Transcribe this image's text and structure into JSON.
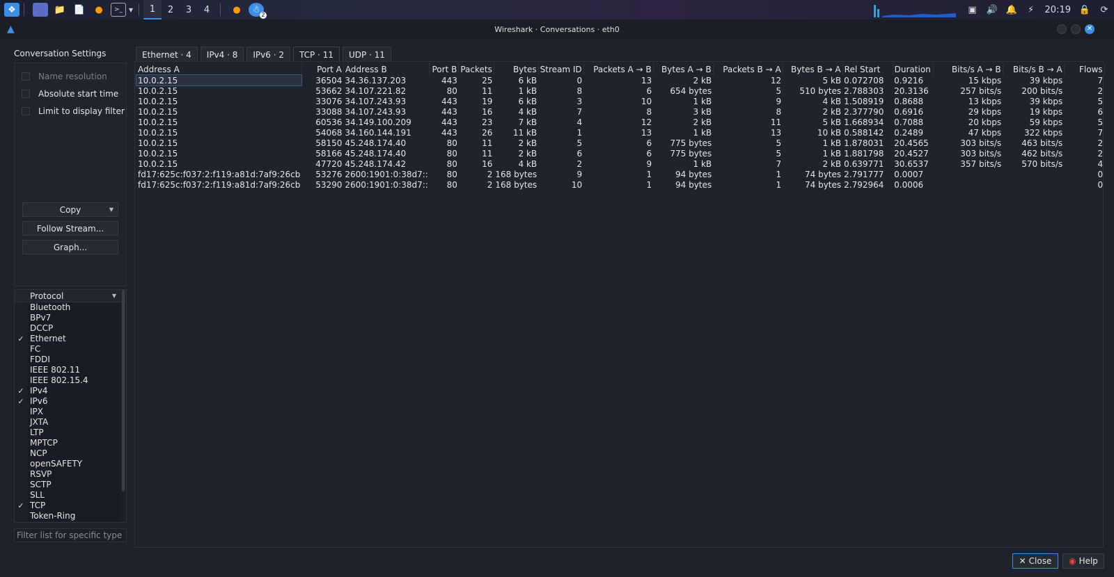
{
  "taskbar": {
    "workspaces": [
      "1",
      "2",
      "3",
      "4"
    ],
    "active_workspace": 0,
    "clock": "20:19",
    "badge": "2"
  },
  "window": {
    "title": "Wireshark · Conversations · eth0"
  },
  "settings": {
    "heading": "Conversation Settings",
    "options": [
      {
        "label": "Name resolution",
        "checked": false,
        "disabled": true
      },
      {
        "label": "Absolute start time",
        "checked": false,
        "disabled": false
      },
      {
        "label": "Limit to display filter",
        "checked": false,
        "disabled": false
      }
    ],
    "copy_label": "Copy",
    "follow_label": "Follow Stream...",
    "graph_label": "Graph..."
  },
  "protocols": {
    "header": "Protocol",
    "items": [
      {
        "name": "Bluetooth",
        "checked": false
      },
      {
        "name": "BPv7",
        "checked": false
      },
      {
        "name": "DCCP",
        "checked": false
      },
      {
        "name": "Ethernet",
        "checked": true
      },
      {
        "name": "FC",
        "checked": false
      },
      {
        "name": "FDDI",
        "checked": false
      },
      {
        "name": "IEEE 802.11",
        "checked": false
      },
      {
        "name": "IEEE 802.15.4",
        "checked": false
      },
      {
        "name": "IPv4",
        "checked": true
      },
      {
        "name": "IPv6",
        "checked": true
      },
      {
        "name": "IPX",
        "checked": false
      },
      {
        "name": "JXTA",
        "checked": false
      },
      {
        "name": "LTP",
        "checked": false
      },
      {
        "name": "MPTCP",
        "checked": false
      },
      {
        "name": "NCP",
        "checked": false
      },
      {
        "name": "openSAFETY",
        "checked": false
      },
      {
        "name": "RSVP",
        "checked": false
      },
      {
        "name": "SCTP",
        "checked": false
      },
      {
        "name": "SLL",
        "checked": false
      },
      {
        "name": "TCP",
        "checked": true
      },
      {
        "name": "Token-Ring",
        "checked": false
      }
    ],
    "filter_placeholder": "Filter list for specific type"
  },
  "tabs": [
    "Ethernet · 4",
    "IPv4 · 8",
    "IPv6 · 2",
    "TCP · 11",
    "UDP · 11"
  ],
  "active_tab": 3,
  "table": {
    "columns": [
      "Address A",
      "Port A",
      "Address B",
      "Port B",
      "Packets",
      "Bytes",
      "Stream ID",
      "Packets A → B",
      "Bytes A → B",
      "Packets B → A",
      "Bytes B → A",
      "Rel Start",
      "Duration",
      "Bits/s A → B",
      "Bits/s B → A",
      "Flows"
    ],
    "rows": [
      [
        "10.0.2.15",
        "36504",
        "34.36.137.203",
        "443",
        "25",
        "6 kB",
        "0",
        "13",
        "2 kB",
        "12",
        "5 kB",
        "0.072708",
        "0.9216",
        "15 kbps",
        "39 kbps",
        "7"
      ],
      [
        "10.0.2.15",
        "53662",
        "34.107.221.82",
        "80",
        "11",
        "1 kB",
        "8",
        "6",
        "654 bytes",
        "5",
        "510 bytes",
        "2.788303",
        "20.3136",
        "257 bits/s",
        "200 bits/s",
        "2"
      ],
      [
        "10.0.2.15",
        "33076",
        "34.107.243.93",
        "443",
        "19",
        "6 kB",
        "3",
        "10",
        "1 kB",
        "9",
        "4 kB",
        "1.508919",
        "0.8688",
        "13 kbps",
        "39 kbps",
        "5"
      ],
      [
        "10.0.2.15",
        "33088",
        "34.107.243.93",
        "443",
        "16",
        "4 kB",
        "7",
        "8",
        "3 kB",
        "8",
        "2 kB",
        "2.377790",
        "0.6916",
        "29 kbps",
        "19 kbps",
        "6"
      ],
      [
        "10.0.2.15",
        "60536",
        "34.149.100.209",
        "443",
        "23",
        "7 kB",
        "4",
        "12",
        "2 kB",
        "11",
        "5 kB",
        "1.668934",
        "0.7088",
        "20 kbps",
        "59 kbps",
        "5"
      ],
      [
        "10.0.2.15",
        "54068",
        "34.160.144.191",
        "443",
        "26",
        "11 kB",
        "1",
        "13",
        "1 kB",
        "13",
        "10 kB",
        "0.588142",
        "0.2489",
        "47 kbps",
        "322 kbps",
        "7"
      ],
      [
        "10.0.2.15",
        "58150",
        "45.248.174.40",
        "80",
        "11",
        "2 kB",
        "5",
        "6",
        "775 bytes",
        "5",
        "1 kB",
        "1.878031",
        "20.4565",
        "303 bits/s",
        "463 bits/s",
        "2"
      ],
      [
        "10.0.2.15",
        "58166",
        "45.248.174.40",
        "80",
        "11",
        "2 kB",
        "6",
        "6",
        "775 bytes",
        "5",
        "1 kB",
        "1.881798",
        "20.4527",
        "303 bits/s",
        "462 bits/s",
        "2"
      ],
      [
        "10.0.2.15",
        "47720",
        "45.248.174.42",
        "80",
        "16",
        "4 kB",
        "2",
        "9",
        "1 kB",
        "7",
        "2 kB",
        "0.639771",
        "30.6537",
        "357 bits/s",
        "570 bits/s",
        "4"
      ],
      [
        "fd17:625c:f037:2:f119:a81d:7af9:26cb",
        "53276",
        "2600:1901:0:38d7::",
        "80",
        "2",
        "168 bytes",
        "9",
        "1",
        "94 bytes",
        "1",
        "74 bytes",
        "2.791777",
        "0.0007",
        "",
        "",
        "0"
      ],
      [
        "fd17:625c:f037:2:f119:a81d:7af9:26cb",
        "53290",
        "2600:1901:0:38d7::",
        "80",
        "2",
        "168 bytes",
        "10",
        "1",
        "94 bytes",
        "1",
        "74 bytes",
        "2.792964",
        "0.0006",
        "",
        "",
        "0"
      ]
    ]
  },
  "footer": {
    "close_label": "Close",
    "help_label": "Help"
  },
  "colors": {
    "accent": "#3b8fe6",
    "background": "#1e222a"
  }
}
